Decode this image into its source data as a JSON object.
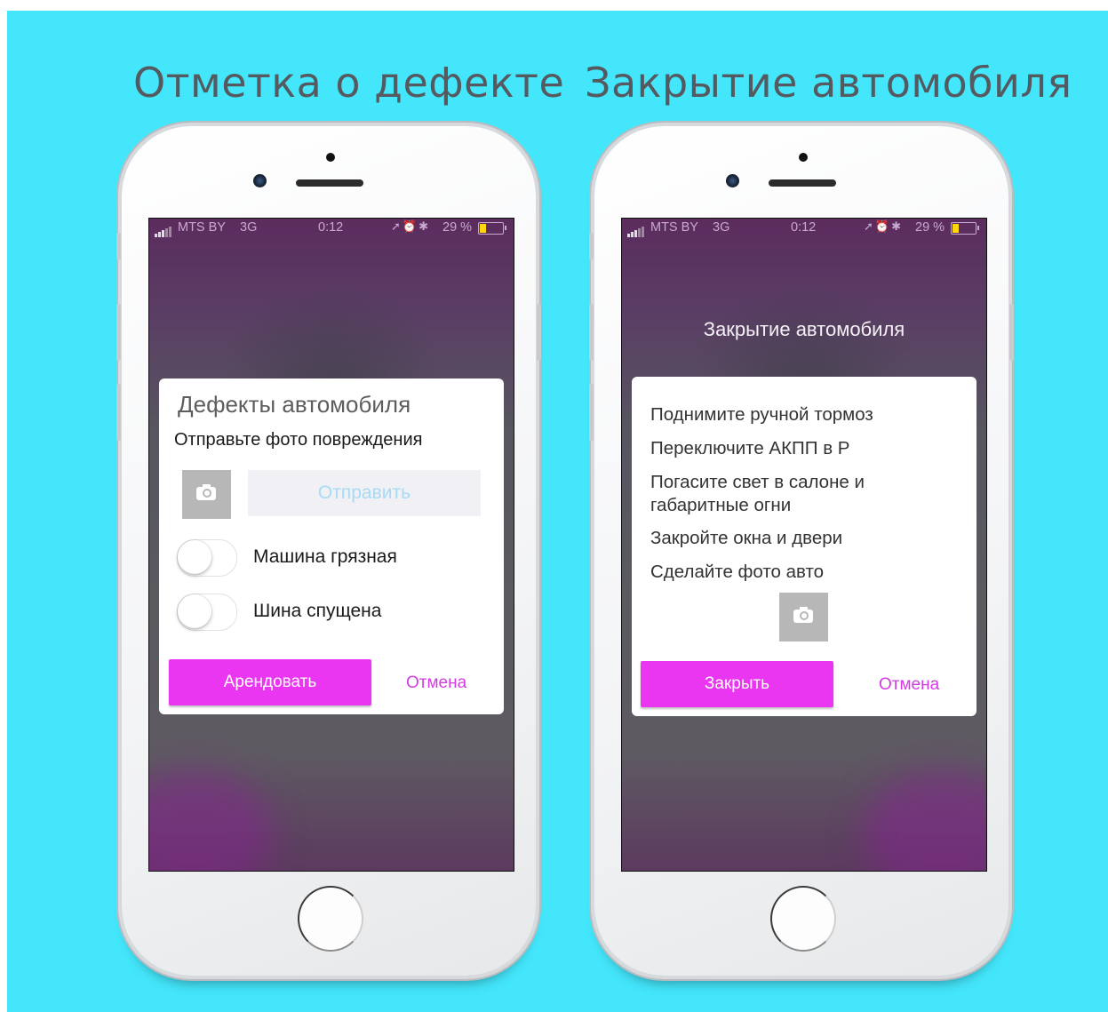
{
  "headlines": {
    "left": "Отметка о дефекте",
    "right": "Закрытие автомобиля"
  },
  "status_bar": {
    "carrier": "MTS BY",
    "network": "3G",
    "time": "0:12",
    "battery": "29 %",
    "battery_color": "#ffd60a"
  },
  "left_screen": {
    "dialog_title": "Дефекты автомобиля",
    "subtitle": "Отправьте фото повреждения",
    "camera_icon": "camera-icon",
    "send_button": "Отправить",
    "toggles": [
      {
        "label": "Машина грязная",
        "on": false
      },
      {
        "label": "Шина спущена",
        "on": false
      }
    ],
    "primary_button": "Арендовать",
    "cancel_link": "Отмена"
  },
  "right_screen": {
    "screen_title": "Закрытие автомобиля",
    "instructions": [
      "Поднимите ручной тормоз",
      "Переключите АКПП в Р",
      "Погасите свет в салоне и габаритные огни",
      "Закройте окна и двери",
      "Сделайте фото авто"
    ],
    "camera_icon": "camera-icon",
    "primary_button": "Закрыть",
    "cancel_link": "Отмена"
  },
  "colors": {
    "background": "#44e6fb",
    "accent": "#ea35f1",
    "headline": "#555a60"
  }
}
